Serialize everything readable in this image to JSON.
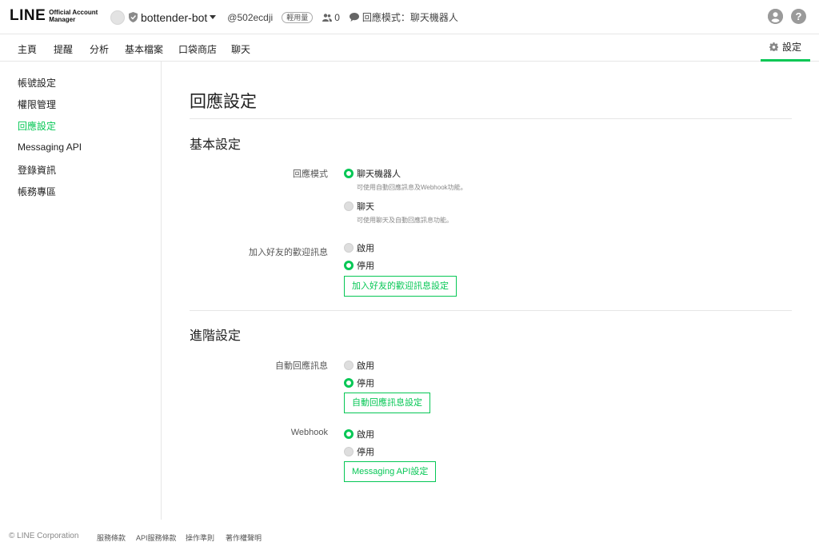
{
  "header": {
    "logo_main": "LINE",
    "logo_sub": "Official Account Manager",
    "account_name": "bottender-bot",
    "account_id": "@502ecdji",
    "plan_badge": "輕用量",
    "friend_count": "0",
    "response_mode": "回應模式：聊天機器人"
  },
  "nav": {
    "items": [
      "主頁",
      "提醒",
      "分析",
      "基本檔案",
      "口袋商店",
      "聊天"
    ],
    "settings_label": "設定"
  },
  "sidebar": {
    "items": [
      "帳號設定",
      "權限管理",
      "回應設定",
      "Messaging API",
      "登錄資訊",
      "帳務專區"
    ],
    "active": "回應設定"
  },
  "main": {
    "title": "回應設定",
    "basic": {
      "title": "基本設定",
      "response_mode": {
        "label": "回應模式",
        "options": [
          {
            "label": "聊天機器人",
            "hint": "可使用自動回應訊息及Webhook功能。",
            "selected": true
          },
          {
            "label": "聊天",
            "hint": "可使用聊天及自動回應訊息功能。",
            "selected": false
          }
        ]
      },
      "welcome": {
        "label": "加入好友的歡迎訊息",
        "options": [
          {
            "label": "啟用",
            "selected": false
          },
          {
            "label": "停用",
            "selected": true
          }
        ],
        "button": "加入好友的歡迎訊息設定"
      }
    },
    "advanced": {
      "title": "進階設定",
      "auto_reply": {
        "label": "自動回應訊息",
        "options": [
          {
            "label": "啟用",
            "selected": false
          },
          {
            "label": "停用",
            "selected": true
          }
        ],
        "button": "自動回應訊息設定"
      },
      "webhook": {
        "label": "Webhook",
        "options": [
          {
            "label": "啟用",
            "selected": true
          },
          {
            "label": "停用",
            "selected": false
          }
        ],
        "button": "Messaging API設定"
      }
    }
  },
  "footer": {
    "copyright": "© LINE Corporation",
    "links": [
      "服務條款",
      "API服務條款",
      "操作準則",
      "著作權聲明"
    ]
  },
  "colors": {
    "accent": "#06c755"
  }
}
